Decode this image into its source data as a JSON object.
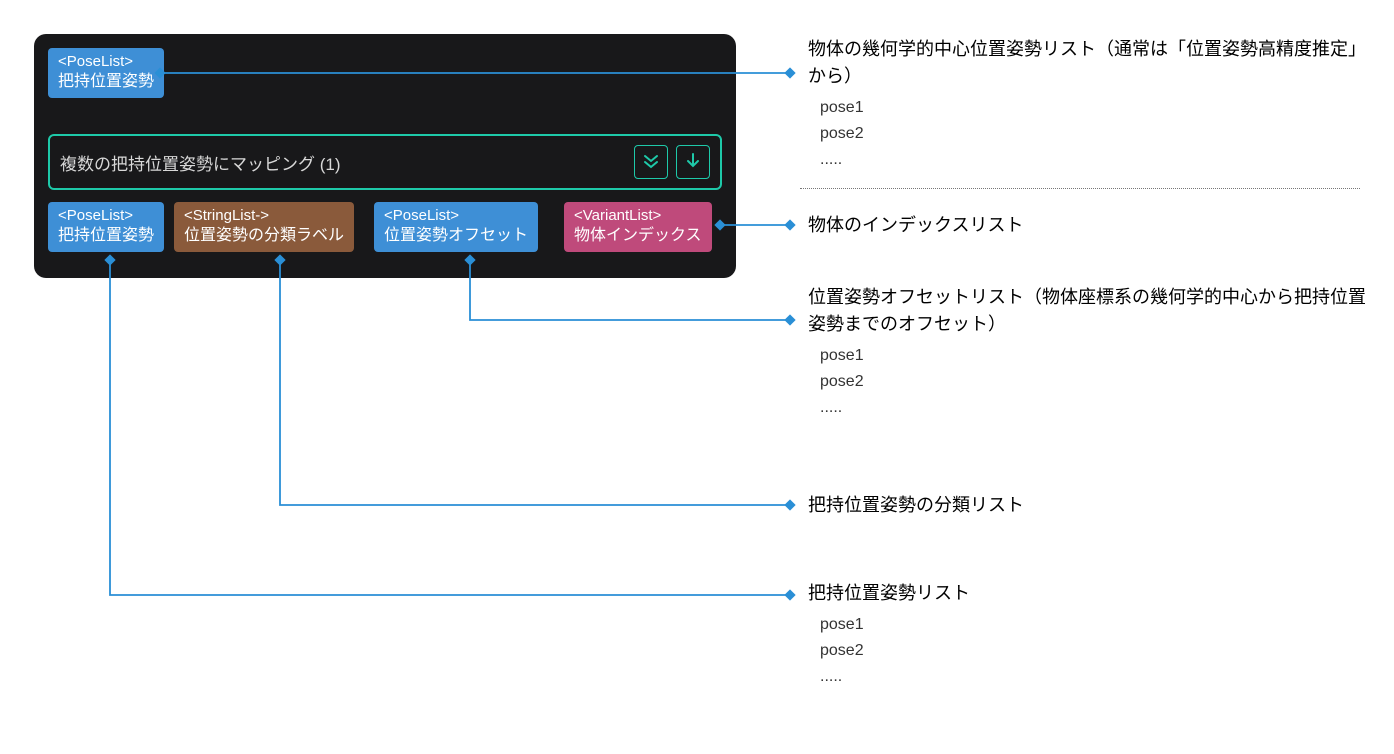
{
  "node": {
    "input_port": {
      "type": "<PoseList>",
      "label": "把持位置姿勢"
    },
    "title": "複数の把持位置姿勢にマッピング (1)",
    "output_ports": [
      {
        "type": "<PoseList>",
        "label": "把持位置姿勢",
        "color": "blue"
      },
      {
        "type": "<StringList->",
        "label": "位置姿勢の分類ラベル",
        "color": "brown"
      },
      {
        "type": "<PoseList>",
        "label": "位置姿勢オフセット",
        "color": "blue"
      },
      {
        "type": "<VariantList>",
        "label": "物体インデックス",
        "color": "magenta"
      }
    ]
  },
  "descriptions": {
    "input": {
      "text": "物体の幾何学的中心位置姿勢リスト（通常は「位置姿勢高精度推定」から）",
      "items": [
        "pose1",
        "pose2",
        "....."
      ]
    },
    "object_index": {
      "text": "物体のインデックスリスト"
    },
    "offset": {
      "text": "位置姿勢オフセットリスト（物体座標系の幾何学的中心から把持位置姿勢までのオフセット）",
      "items": [
        "pose1",
        "pose2",
        "....."
      ]
    },
    "classify": {
      "text": "把持位置姿勢の分類リスト"
    },
    "grasp": {
      "text": "把持位置姿勢リスト",
      "items": [
        "pose1",
        "pose2",
        "....."
      ]
    }
  }
}
